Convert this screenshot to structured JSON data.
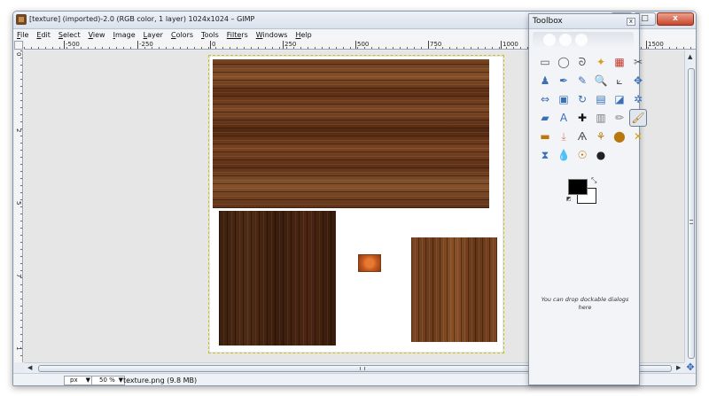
{
  "window": {
    "title": "[texture] (imported)-2.0 (RGB color, 1 layer) 1024x1024 – GIMP",
    "controls": {
      "minimize": "–",
      "maximize": "□",
      "close": "x"
    }
  },
  "menubar": [
    {
      "u": "F",
      "rest": "ile"
    },
    {
      "u": "E",
      "rest": "dit"
    },
    {
      "u": "S",
      "rest": "elect"
    },
    {
      "u": "V",
      "rest": "iew"
    },
    {
      "u": "I",
      "rest": "mage"
    },
    {
      "u": "L",
      "rest": "ayer"
    },
    {
      "u": "C",
      "rest": "olors"
    },
    {
      "u": "T",
      "rest": "ools"
    },
    {
      "u": "Filte",
      "rest": "rs"
    },
    {
      "u": "W",
      "rest": "indows"
    },
    {
      "u": "H",
      "rest": "elp"
    }
  ],
  "ruler": {
    "h_labels": [
      "-500",
      "-250",
      "0",
      "250",
      "500",
      "750",
      "1000",
      "1500"
    ],
    "v_labels": [
      "0",
      "2",
      "5",
      "7",
      "1"
    ]
  },
  "statusbar": {
    "unit": "px",
    "zoom": "50 %",
    "file_info": "texture.png (9.8 MB)"
  },
  "toolbox": {
    "title": "Toolbox",
    "close": "x",
    "tools": [
      "rect-select",
      "ellipse-select",
      "free-select",
      "fuzzy-select",
      "color-select",
      "scissors-select",
      "foreground-select",
      "paths",
      "color-picker",
      "zoom",
      "measure",
      "move",
      "align",
      "crop",
      "rotate",
      "scale",
      "shear",
      "perspective",
      "flip",
      "cage",
      "text",
      "heal",
      "blend",
      "pencil",
      "paintbrush",
      "eraser",
      "airbrush",
      "ink",
      "clone",
      "perspective-clone",
      "blur",
      "smudge",
      "dodge-burn",
      "bucket-fill"
    ],
    "tool_glyphs": [
      "▭",
      "◯",
      "ᘐ",
      "✦",
      "▦",
      "✂",
      "♟",
      "✒",
      "✎",
      "🔍",
      "⟀",
      "✥",
      "⇔",
      "▣",
      "↻",
      "▤",
      "◪",
      "✲",
      "▰",
      "A",
      "✚",
      "▥",
      "✏",
      "🖌",
      "▬",
      "⤓",
      "Ѧ",
      "⚘",
      "⬤",
      "✕",
      "⧗",
      "💧",
      "☉",
      "●"
    ],
    "active_tool": "pencil",
    "fg_color": "#000000",
    "bg_color": "#ffffff",
    "drop_hint": "You can drop dockable dialogs here"
  },
  "colors": {
    "accent": "#2b62b8",
    "close_button": "#c8452c",
    "canvas_bg": "#e6e6e6",
    "selection_border": "#c8c020"
  }
}
